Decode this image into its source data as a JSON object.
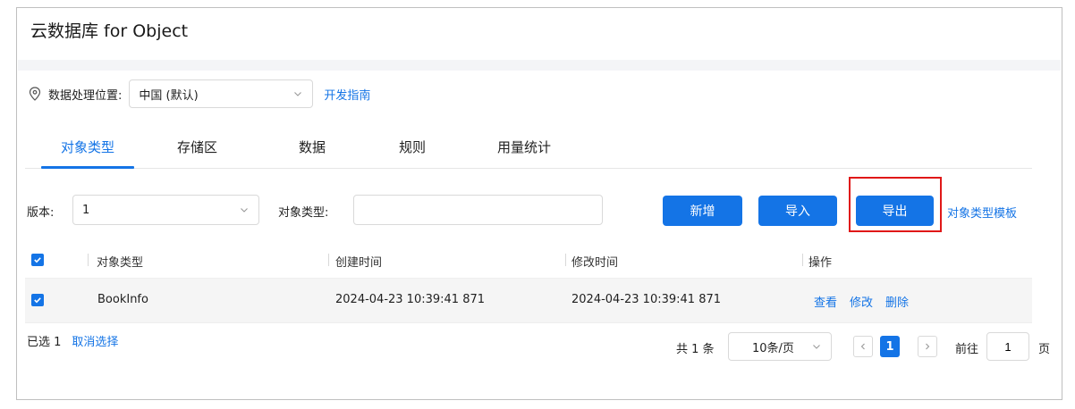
{
  "page_title": "云数据库 for Object",
  "location": {
    "label": "数据处理位置:",
    "selected": "中国 (默认)",
    "guide_link": "开发指南"
  },
  "tabs": [
    {
      "label": "对象类型",
      "active": true
    },
    {
      "label": "存储区",
      "active": false
    },
    {
      "label": "数据",
      "active": false
    },
    {
      "label": "规则",
      "active": false
    },
    {
      "label": "用量统计",
      "active": false
    }
  ],
  "toolbar": {
    "version_label": "版本:",
    "version_value": "1",
    "type_label": "对象类型:",
    "type_input_value": "",
    "new_label": "新增",
    "import_label": "导入",
    "export_label": "导出",
    "template_link": "对象类型模板"
  },
  "table": {
    "headers": [
      "对象类型",
      "创建时间",
      "修改时间",
      "操作"
    ],
    "rows": [
      {
        "checked": true,
        "name": "BookInfo",
        "created": "2024-04-23 10:39:41 871",
        "modified": "2024-04-23 10:39:41 871",
        "actions": [
          "查看",
          "修改",
          "删除"
        ]
      }
    ]
  },
  "selection": {
    "selected_text": "已选 1",
    "cancel_label": "取消选择"
  },
  "pagination": {
    "total_text": "共 1 条",
    "page_size": "10条/页",
    "current_page": "1",
    "goto_label": "前往",
    "goto_value": "1",
    "page_unit": "页"
  },
  "colors": {
    "primary": "#1474e6",
    "highlight": "#e01818"
  }
}
